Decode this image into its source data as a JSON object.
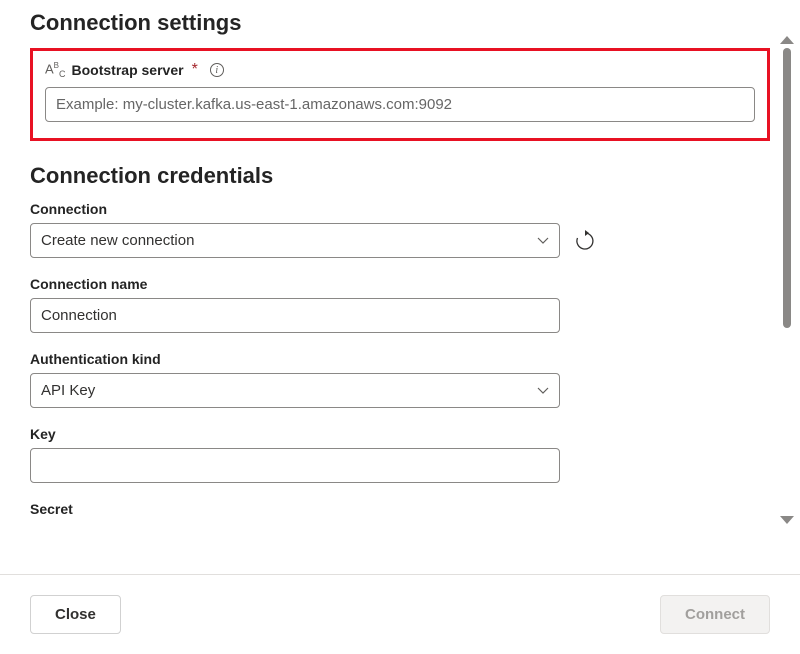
{
  "sections": {
    "connection_settings": {
      "heading": "Connection settings",
      "bootstrap_server": {
        "label": "Bootstrap server",
        "placeholder": "Example: my-cluster.kafka.us-east-1.amazonaws.com:9092",
        "value": ""
      }
    },
    "connection_credentials": {
      "heading": "Connection credentials",
      "connection": {
        "label": "Connection",
        "value": "Create new connection"
      },
      "connection_name": {
        "label": "Connection name",
        "value": "Connection"
      },
      "authentication_kind": {
        "label": "Authentication kind",
        "value": "API Key"
      },
      "key": {
        "label": "Key",
        "value": ""
      },
      "secret": {
        "label": "Secret",
        "value": ""
      }
    }
  },
  "footer": {
    "close_label": "Close",
    "connect_label": "Connect"
  }
}
